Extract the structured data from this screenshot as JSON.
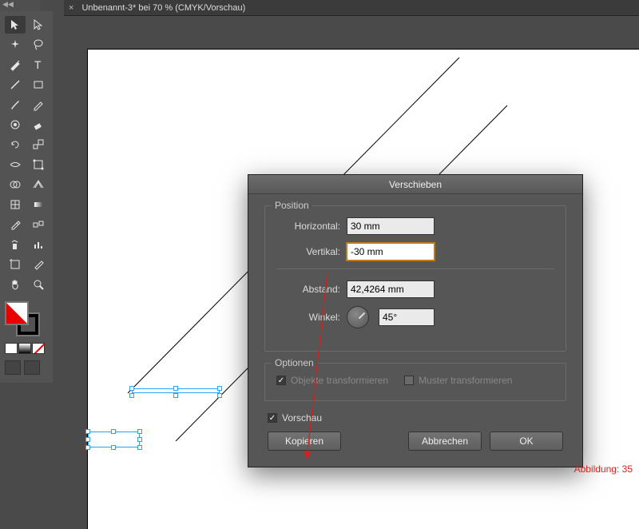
{
  "title": "Unbenannt-3* bei 70 % (CMYK/Vorschau)",
  "toolbox": {
    "collapse_label": "◀◀"
  },
  "dialog": {
    "title": "Verschieben",
    "position_group": "Position",
    "horizontal_label": "Horizontal:",
    "horizontal_value": "30 mm",
    "vertical_label": "Vertikal:",
    "vertical_value": "-30 mm",
    "distance_label": "Abstand:",
    "distance_value": "42,4264 mm",
    "angle_label": "Winkel:",
    "angle_value": "45°",
    "options_group": "Optionen",
    "transform_objects": "Objekte transformieren",
    "transform_patterns": "Muster transformieren",
    "preview": "Vorschau",
    "copy": "Kopieren",
    "cancel": "Abbrechen",
    "ok": "OK"
  },
  "caption": "Abbildung: 35"
}
